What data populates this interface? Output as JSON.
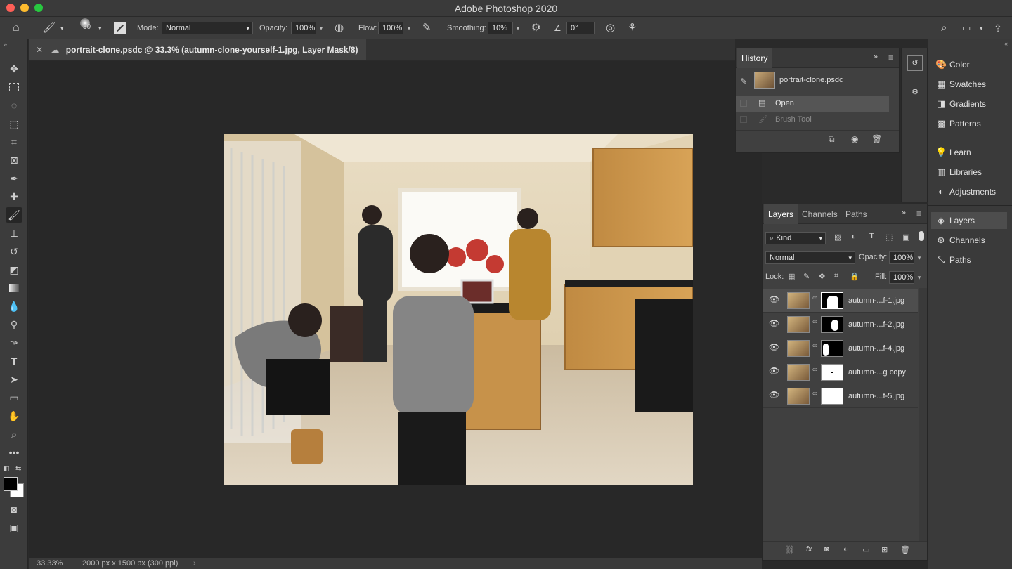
{
  "window": {
    "title": "Adobe Photoshop 2020"
  },
  "options_bar": {
    "brush_size": "30",
    "mode_label": "Mode:",
    "mode_value": "Normal",
    "opacity_label": "Opacity:",
    "opacity_value": "100%",
    "flow_label": "Flow:",
    "flow_value": "100%",
    "smoothing_label": "Smoothing:",
    "smoothing_value": "10%",
    "angle_value": "0°"
  },
  "document_tab": {
    "label": "portrait-clone.psdc @ 33.3% (autumn-clone-yourself-1.jpg, Layer Mask/8)"
  },
  "status_bar": {
    "zoom": "33.33%",
    "doc_info": "2000 px x 1500 px (300 ppi)"
  },
  "history_panel": {
    "title": "History",
    "snapshot_name": "portrait-clone.psdc",
    "states": [
      {
        "label": "Open"
      },
      {
        "label": "Brush Tool"
      }
    ]
  },
  "dock": {
    "group1": [
      {
        "label": "Color",
        "icon": "palette-icon"
      },
      {
        "label": "Swatches",
        "icon": "grid-icon"
      },
      {
        "label": "Gradients",
        "icon": "gradient-icon"
      },
      {
        "label": "Patterns",
        "icon": "pattern-icon"
      }
    ],
    "group2": [
      {
        "label": "Learn",
        "icon": "bulb-icon"
      },
      {
        "label": "Libraries",
        "icon": "library-icon"
      },
      {
        "label": "Adjustments",
        "icon": "adjustment-icon"
      }
    ],
    "group3": [
      {
        "label": "Layers",
        "icon": "layers-icon"
      },
      {
        "label": "Channels",
        "icon": "channels-icon"
      },
      {
        "label": "Paths",
        "icon": "paths-icon"
      }
    ]
  },
  "layers_panel": {
    "tabs": [
      "Layers",
      "Channels",
      "Paths"
    ],
    "filter_kind": "Kind",
    "blend_mode": "Normal",
    "opacity_label": "Opacity:",
    "opacity_value": "100%",
    "lock_label": "Lock:",
    "fill_label": "Fill:",
    "fill_value": "100%",
    "layers": [
      {
        "name": "autumn-...f-1.jpg"
      },
      {
        "name": "autumn-...f-2.jpg"
      },
      {
        "name": "autumn-...f-4.jpg"
      },
      {
        "name": "autumn-...g copy"
      },
      {
        "name": "autumn-...f-5.jpg"
      }
    ]
  }
}
